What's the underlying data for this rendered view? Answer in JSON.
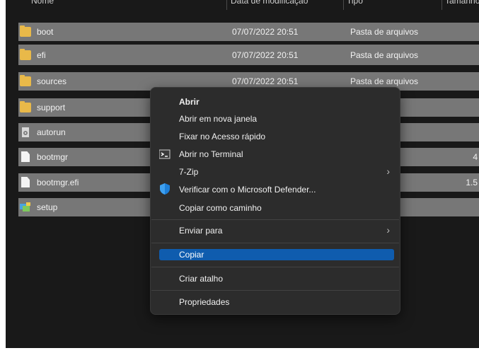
{
  "columns": [
    "Nome",
    "Data de modificação",
    "Tipo",
    "Tamanho"
  ],
  "files": [
    {
      "name": "boot",
      "date": "07/07/2022 20:51",
      "type": "Pasta de arquivos",
      "size": "",
      "icon": "folder-icon"
    },
    {
      "name": "efi",
      "date": "07/07/2022 20:51",
      "type": "Pasta de arquivos",
      "size": "",
      "icon": "folder-icon"
    },
    {
      "name": "sources",
      "date": "07/07/2022 20:51",
      "type": "Pasta de arquivos",
      "size": "",
      "icon": "folder-icon"
    },
    {
      "name": "support",
      "date": "",
      "type": "quivos",
      "size": "",
      "icon": "folder-icon"
    },
    {
      "name": "autorun",
      "date": "",
      "type": "s de C...",
      "size": "",
      "icon": "settings-file-icon"
    },
    {
      "name": "bootmgr",
      "date": "",
      "type": "",
      "size": "4",
      "icon": "file-icon"
    },
    {
      "name": "bootmgr.efi",
      "date": "",
      "type": "",
      "size": "1.5",
      "icon": "file-icon"
    },
    {
      "name": "setup",
      "date": "",
      "type": "",
      "size": "",
      "icon": "setup-icon"
    }
  ],
  "context_menu": {
    "open": "Abrir",
    "open_new_window": "Abrir em nova janela",
    "pin_quick_access": "Fixar no Acesso rápido",
    "open_terminal": "Abrir no Terminal",
    "seven_zip": "7-Zip",
    "defender_scan": "Verificar com o Microsoft Defender...",
    "copy_as_path": "Copiar como caminho",
    "send_to": "Enviar para",
    "copy": "Copiar",
    "create_shortcut": "Criar atalho",
    "properties": "Propriedades",
    "chevron": "›"
  },
  "colors": {
    "background": "#191919",
    "selection": "#777777",
    "menu_background": "#2c2c2c",
    "highlight": "#0f5cae",
    "folder": "#e9b949"
  }
}
